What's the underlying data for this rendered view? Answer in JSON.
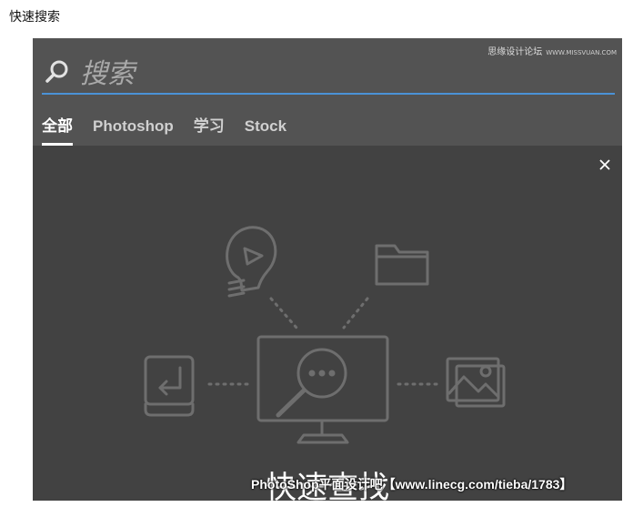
{
  "page_caption": "快速搜索",
  "watermark_top": {
    "site_name": "思缘设计论坛",
    "site_url": "WWW.MISSVUAN.COM"
  },
  "search": {
    "placeholder": "搜索"
  },
  "tabs": [
    {
      "label": "全部",
      "active": true
    },
    {
      "label": "Photoshop",
      "active": false
    },
    {
      "label": "学习",
      "active": false
    },
    {
      "label": "Stock",
      "active": false
    }
  ],
  "main": {
    "title": "快速查找"
  },
  "watermark_bottom": "PhotoShop平面设计吧【www.linecg.com/tieba/1783】",
  "colors": {
    "panel": "#535353",
    "content": "#424242",
    "accent": "#4b92d6",
    "illustration_stroke": "#6e6e6e"
  },
  "icons": [
    "search-icon",
    "close-icon",
    "lightbulb-play-icon",
    "folder-icon",
    "monitor-search-icon",
    "return-key-icon",
    "image-stack-icon"
  ]
}
